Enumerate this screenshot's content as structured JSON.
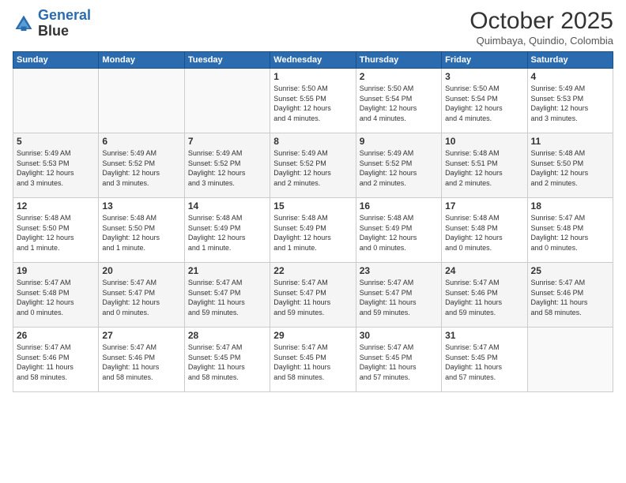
{
  "header": {
    "logo_line1": "General",
    "logo_line2": "Blue",
    "month": "October 2025",
    "location": "Quimbaya, Quindio, Colombia"
  },
  "weekdays": [
    "Sunday",
    "Monday",
    "Tuesday",
    "Wednesday",
    "Thursday",
    "Friday",
    "Saturday"
  ],
  "weeks": [
    [
      {
        "day": "",
        "info": ""
      },
      {
        "day": "",
        "info": ""
      },
      {
        "day": "",
        "info": ""
      },
      {
        "day": "1",
        "info": "Sunrise: 5:50 AM\nSunset: 5:55 PM\nDaylight: 12 hours\nand 4 minutes."
      },
      {
        "day": "2",
        "info": "Sunrise: 5:50 AM\nSunset: 5:54 PM\nDaylight: 12 hours\nand 4 minutes."
      },
      {
        "day": "3",
        "info": "Sunrise: 5:50 AM\nSunset: 5:54 PM\nDaylight: 12 hours\nand 4 minutes."
      },
      {
        "day": "4",
        "info": "Sunrise: 5:49 AM\nSunset: 5:53 PM\nDaylight: 12 hours\nand 3 minutes."
      }
    ],
    [
      {
        "day": "5",
        "info": "Sunrise: 5:49 AM\nSunset: 5:53 PM\nDaylight: 12 hours\nand 3 minutes."
      },
      {
        "day": "6",
        "info": "Sunrise: 5:49 AM\nSunset: 5:52 PM\nDaylight: 12 hours\nand 3 minutes."
      },
      {
        "day": "7",
        "info": "Sunrise: 5:49 AM\nSunset: 5:52 PM\nDaylight: 12 hours\nand 3 minutes."
      },
      {
        "day": "8",
        "info": "Sunrise: 5:49 AM\nSunset: 5:52 PM\nDaylight: 12 hours\nand 2 minutes."
      },
      {
        "day": "9",
        "info": "Sunrise: 5:49 AM\nSunset: 5:52 PM\nDaylight: 12 hours\nand 2 minutes."
      },
      {
        "day": "10",
        "info": "Sunrise: 5:48 AM\nSunset: 5:51 PM\nDaylight: 12 hours\nand 2 minutes."
      },
      {
        "day": "11",
        "info": "Sunrise: 5:48 AM\nSunset: 5:50 PM\nDaylight: 12 hours\nand 2 minutes."
      }
    ],
    [
      {
        "day": "12",
        "info": "Sunrise: 5:48 AM\nSunset: 5:50 PM\nDaylight: 12 hours\nand 1 minute."
      },
      {
        "day": "13",
        "info": "Sunrise: 5:48 AM\nSunset: 5:50 PM\nDaylight: 12 hours\nand 1 minute."
      },
      {
        "day": "14",
        "info": "Sunrise: 5:48 AM\nSunset: 5:49 PM\nDaylight: 12 hours\nand 1 minute."
      },
      {
        "day": "15",
        "info": "Sunrise: 5:48 AM\nSunset: 5:49 PM\nDaylight: 12 hours\nand 1 minute."
      },
      {
        "day": "16",
        "info": "Sunrise: 5:48 AM\nSunset: 5:49 PM\nDaylight: 12 hours\nand 0 minutes."
      },
      {
        "day": "17",
        "info": "Sunrise: 5:48 AM\nSunset: 5:48 PM\nDaylight: 12 hours\nand 0 minutes."
      },
      {
        "day": "18",
        "info": "Sunrise: 5:47 AM\nSunset: 5:48 PM\nDaylight: 12 hours\nand 0 minutes."
      }
    ],
    [
      {
        "day": "19",
        "info": "Sunrise: 5:47 AM\nSunset: 5:48 PM\nDaylight: 12 hours\nand 0 minutes."
      },
      {
        "day": "20",
        "info": "Sunrise: 5:47 AM\nSunset: 5:47 PM\nDaylight: 12 hours\nand 0 minutes."
      },
      {
        "day": "21",
        "info": "Sunrise: 5:47 AM\nSunset: 5:47 PM\nDaylight: 11 hours\nand 59 minutes."
      },
      {
        "day": "22",
        "info": "Sunrise: 5:47 AM\nSunset: 5:47 PM\nDaylight: 11 hours\nand 59 minutes."
      },
      {
        "day": "23",
        "info": "Sunrise: 5:47 AM\nSunset: 5:47 PM\nDaylight: 11 hours\nand 59 minutes."
      },
      {
        "day": "24",
        "info": "Sunrise: 5:47 AM\nSunset: 5:46 PM\nDaylight: 11 hours\nand 59 minutes."
      },
      {
        "day": "25",
        "info": "Sunrise: 5:47 AM\nSunset: 5:46 PM\nDaylight: 11 hours\nand 58 minutes."
      }
    ],
    [
      {
        "day": "26",
        "info": "Sunrise: 5:47 AM\nSunset: 5:46 PM\nDaylight: 11 hours\nand 58 minutes."
      },
      {
        "day": "27",
        "info": "Sunrise: 5:47 AM\nSunset: 5:46 PM\nDaylight: 11 hours\nand 58 minutes."
      },
      {
        "day": "28",
        "info": "Sunrise: 5:47 AM\nSunset: 5:45 PM\nDaylight: 11 hours\nand 58 minutes."
      },
      {
        "day": "29",
        "info": "Sunrise: 5:47 AM\nSunset: 5:45 PM\nDaylight: 11 hours\nand 58 minutes."
      },
      {
        "day": "30",
        "info": "Sunrise: 5:47 AM\nSunset: 5:45 PM\nDaylight: 11 hours\nand 57 minutes."
      },
      {
        "day": "31",
        "info": "Sunrise: 5:47 AM\nSunset: 5:45 PM\nDaylight: 11 hours\nand 57 minutes."
      },
      {
        "day": "",
        "info": ""
      }
    ]
  ]
}
